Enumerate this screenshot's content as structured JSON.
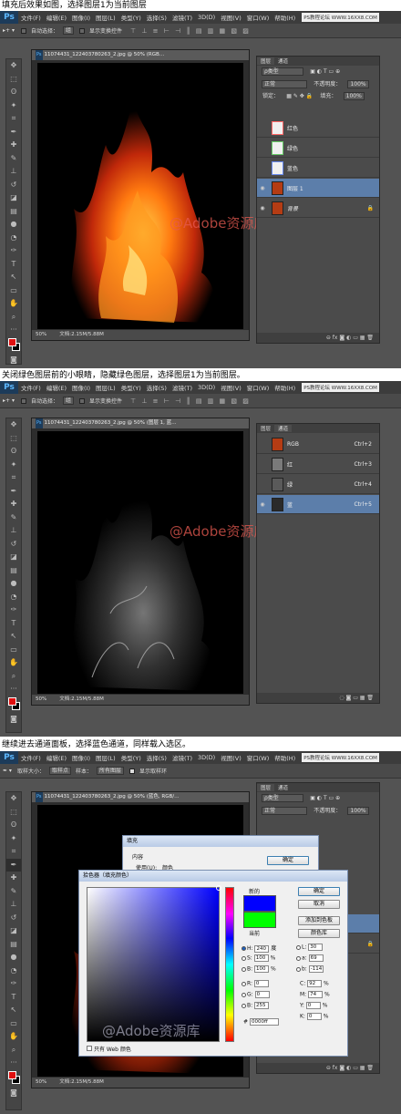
{
  "captions": [
    "填充后效果如图，选择图层1为当前图层",
    "关闭绿色图层前的小眼睛，隐藏绿色图层，选择图层1为当前图层。",
    "继续进去通道面板，选择蓝色通道，同样载入选区。"
  ],
  "menu": {
    "logo": "Ps",
    "items": [
      "文件(F)",
      "编辑(E)",
      "图像(I)",
      "图层(L)",
      "类型(Y)",
      "选择(S)",
      "滤镜(T)",
      "3D(D)",
      "视图(V)",
      "窗口(W)",
      "帮助(H)"
    ],
    "site_badge": "PS教程论坛 WWW.16XX8.COM"
  },
  "optbar_move": {
    "auto_select": "自动选择：",
    "auto_select_value": "组",
    "show_transform": "显示变换控件",
    "align_icons": "⊤ ⊥ ≡ ⊢ ⊣ ║ ▤ ▥ ▦ ▧ ▨"
  },
  "optbar_eyedropper": {
    "sample_size_label": "取样大小：",
    "sample_size_value": "取样点",
    "sample_label": "样本：",
    "sample_value": "所有图层",
    "show_ring": "显示取样环"
  },
  "doc1": {
    "tab": "11074431_1224037802​63_2.jpg @ 50% (RGB…",
    "zoom": "50%",
    "doc_size": "文档:2.15M/5.88M"
  },
  "doc2": {
    "tab": "11074431_122403780263_2.jpg @ 50% (图层 1, 蓝…",
    "zoom": "50%",
    "doc_size": "文档:2.15M/5.88M"
  },
  "doc3": {
    "tab": "11074431_122403780263_2.jpg @ 50% (蓝色, RGB/…",
    "zoom": "50%",
    "doc_size": "文档:2.15M/5.88M"
  },
  "layers_panel": {
    "tabs": [
      "图层",
      "通道"
    ],
    "kind_filter": "ρ类型",
    "blend_mode": "正常",
    "opacity_label": "不透明度：",
    "opacity_value": "100%",
    "lock_label": "锁定：",
    "fill_label": "填充：",
    "fill_value": "100%",
    "layers": [
      {
        "name": "红色",
        "visible": false,
        "selected": false,
        "thumb": "#ff6666"
      },
      {
        "name": "绿色",
        "visible": false,
        "selected": false,
        "thumb": "#66cc66"
      },
      {
        "name": "蓝色",
        "visible": false,
        "selected": false,
        "thumb": "#6688ee"
      },
      {
        "name": "图层 1",
        "visible": true,
        "selected": true,
        "thumb": "#b43c14"
      },
      {
        "name": "背景",
        "visible": true,
        "selected": false,
        "thumb": "#b43c14",
        "locked": true
      }
    ],
    "footer_icons": "⊖ fx ◙ ◐ ▭ ▦ 🗑"
  },
  "channels_panel": {
    "tabs": [
      "图层",
      "通道"
    ],
    "channels": [
      {
        "name": "RGB",
        "shortcut": "Ctrl+2",
        "visible": false,
        "selected": false
      },
      {
        "name": "红",
        "shortcut": "Ctrl+3",
        "visible": false,
        "selected": false
      },
      {
        "name": "绿",
        "shortcut": "Ctrl+4",
        "visible": false,
        "selected": false
      },
      {
        "name": "蓝",
        "shortcut": "Ctrl+5",
        "visible": true,
        "selected": true
      }
    ],
    "footer_icons": "◌ ◙ ▭ ▦ 🗑"
  },
  "fill_dialog": {
    "title": "填充",
    "content_label": "内容",
    "use_label": "使用(U):",
    "use_value": "颜色",
    "ok": "确定"
  },
  "color_picker": {
    "title": "拾色器（填充颜色）",
    "new_label": "新的",
    "current_label": "当前",
    "ok": "确定",
    "cancel": "取消",
    "add_swatch": "添加到色板",
    "color_libs": "颜色库",
    "web_only": "只有 Web 颜色",
    "new_color": "#0000ff",
    "current_color": "#00ff00",
    "H": "240",
    "H_unit": "度",
    "S": "100",
    "S_unit": "%",
    "Bv": "100",
    "B_unit": "%",
    "R": "0",
    "G": "0",
    "B": "255",
    "L": "30",
    "a": "69",
    "b": "-114",
    "C": "92",
    "M": "74",
    "Y": "0",
    "K": "0",
    "hex_label": "#",
    "hex": "0000ff"
  },
  "watermark": "@Adobe资源库"
}
